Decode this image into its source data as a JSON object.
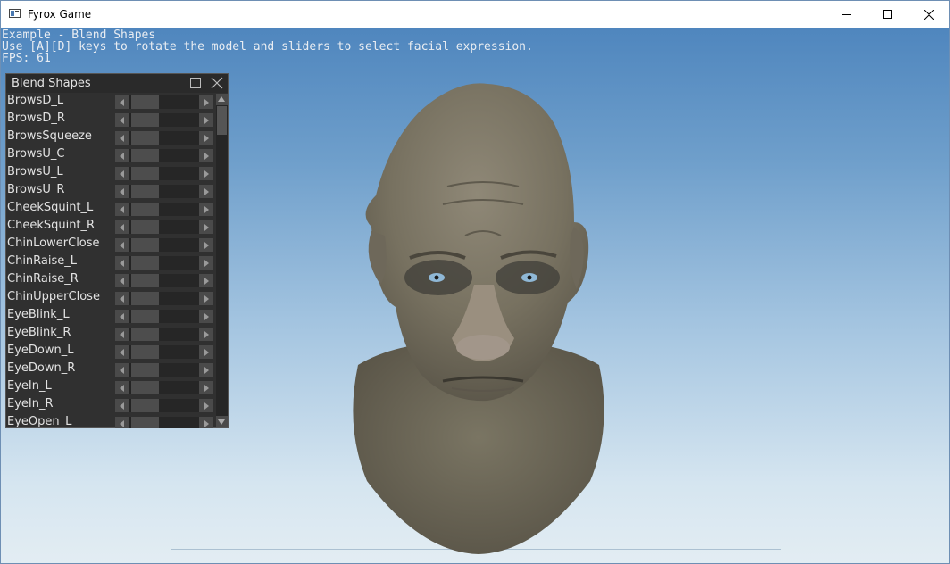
{
  "window": {
    "title": "Fyrox Game"
  },
  "overlay": {
    "line1": "Example - Blend Shapes",
    "line2": "Use [A][D] keys to rotate the model and sliders to select facial expression.",
    "line3": "FPS: 61"
  },
  "panel": {
    "title": "Blend Shapes",
    "rows": [
      {
        "label": "BrowsD_L",
        "value": 0
      },
      {
        "label": "BrowsD_R",
        "value": 0
      },
      {
        "label": "BrowsSqueeze",
        "value": 0
      },
      {
        "label": "BrowsU_C",
        "value": 0
      },
      {
        "label": "BrowsU_L",
        "value": 0
      },
      {
        "label": "BrowsU_R",
        "value": 0
      },
      {
        "label": "CheekSquint_L",
        "value": 0
      },
      {
        "label": "CheekSquint_R",
        "value": 0
      },
      {
        "label": "ChinLowerClose",
        "value": 0
      },
      {
        "label": "ChinRaise_L",
        "value": 0
      },
      {
        "label": "ChinRaise_R",
        "value": 0
      },
      {
        "label": "ChinUpperClose",
        "value": 0
      },
      {
        "label": "EyeBlink_L",
        "value": 0
      },
      {
        "label": "EyeBlink_R",
        "value": 0
      },
      {
        "label": "EyeDown_L",
        "value": 0
      },
      {
        "label": "EyeDown_R",
        "value": 0
      },
      {
        "label": "EyeIn_L",
        "value": 0
      },
      {
        "label": "EyeIn_R",
        "value": 0
      },
      {
        "label": "EyeOpen_L",
        "value": 0
      }
    ]
  },
  "colors": {
    "sky_top": "#4f86be",
    "sky_bottom": "#e3edf3",
    "panel_bg": "#303030",
    "skin": "#7d7766"
  }
}
